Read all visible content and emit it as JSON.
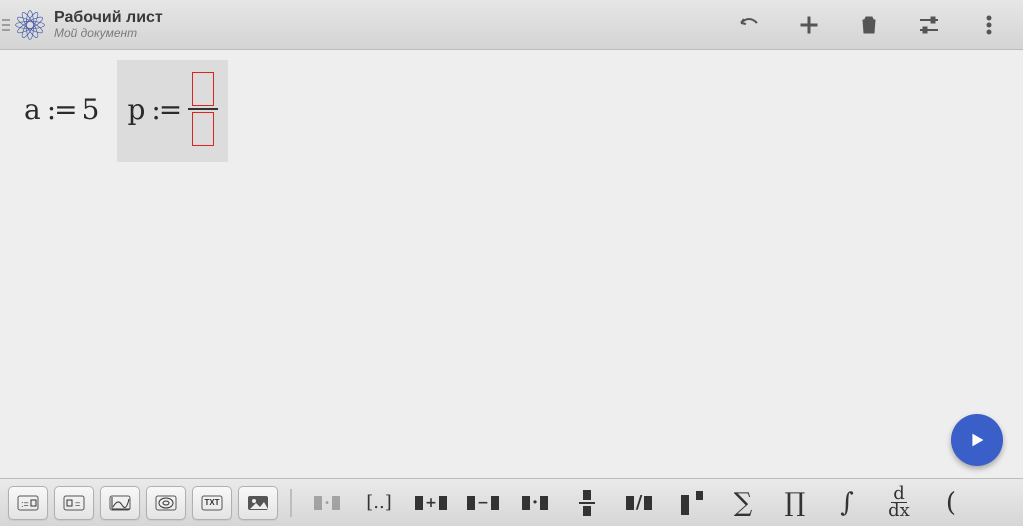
{
  "header": {
    "title": "Рабочий лист",
    "subtitle": "Мой документ"
  },
  "formulas": {
    "a_var": "a",
    "a_assign": ":=",
    "a_value": "5",
    "p_var": "p",
    "p_assign": ":="
  },
  "bottom": {
    "txt_label": "TXT",
    "sigma": "∑",
    "pi": "∏",
    "integral": "∫",
    "paren": "(",
    "deriv_top": "d",
    "deriv_bot": "dx"
  }
}
